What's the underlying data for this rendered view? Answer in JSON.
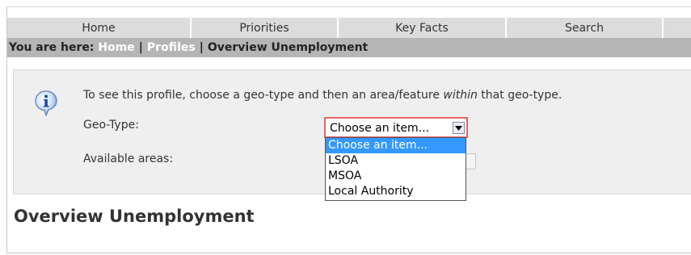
{
  "nav": {
    "items": [
      {
        "label": "Home"
      },
      {
        "label": "Priorities"
      },
      {
        "label": "Key Facts"
      },
      {
        "label": "Search"
      },
      {
        "label": ""
      }
    ]
  },
  "breadcrumb": {
    "prefix": "You are here:",
    "items": [
      "Home",
      "Profiles"
    ],
    "current": "Overview Unemployment",
    "separator": "|"
  },
  "info": {
    "text_before": "To see this profile, choose a geo-type and then an area/feature ",
    "text_italic": "within",
    "text_after": " that geo-type.",
    "icon": "info-icon"
  },
  "form": {
    "geo_type_label": "Geo-Type:",
    "geo_type_value": "Choose an item...",
    "available_areas_label": "Available areas:"
  },
  "dropdown": {
    "options": [
      "Choose an item...",
      "LSOA",
      "MSOA",
      "Local Authority"
    ],
    "selected_index": 0
  },
  "page": {
    "heading": "Overview Unemployment"
  },
  "colors": {
    "nav_bg": "#dcdcdc",
    "breadcrumb_bg": "#b5b5b5",
    "panel_bg": "#efefef",
    "select_focus_border": "#e86666",
    "dropdown_highlight": "#3399ff"
  }
}
